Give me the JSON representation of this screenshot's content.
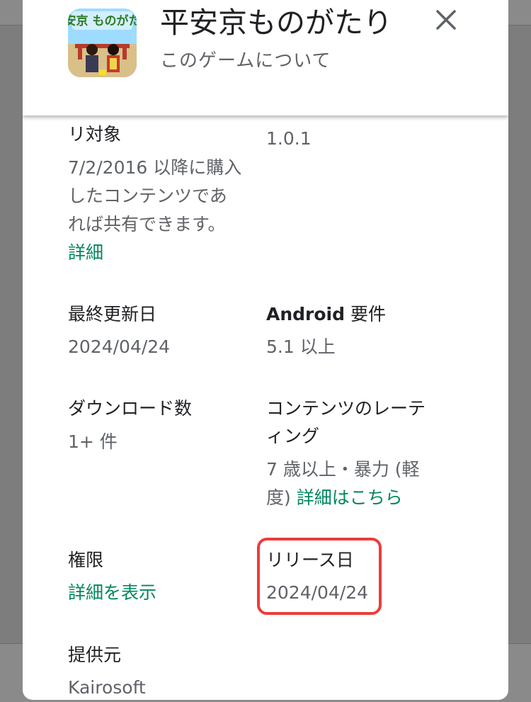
{
  "app": {
    "title": "平安京ものがたり",
    "subtitle": "このゲームについて",
    "icon_logo_text": "平安京 ものがたり"
  },
  "colors": {
    "link": "#01875f",
    "highlight": "#ee3b3b",
    "label": "#202124",
    "value": "#5f6368"
  },
  "icons": {
    "close": "close-icon",
    "app": "app-icon"
  },
  "details": {
    "family_library": {
      "label": "リ対象",
      "value_lines": [
        "7/2/2016 以降に購入",
        "したコンテンツであ",
        "れば共有できます。"
      ],
      "link": "詳細"
    },
    "version": {
      "value": "1.0.1"
    },
    "updated": {
      "label": "最終更新日",
      "value": "2024/04/24"
    },
    "android_req": {
      "label_bold": "Android",
      "label_rest": " 要件",
      "value": "5.1 以上"
    },
    "downloads": {
      "label": "ダウンロード数",
      "value": "1+ 件"
    },
    "rating": {
      "label_lines": [
        "コンテンツのレーテ",
        "ィング"
      ],
      "value_line1": "7 歳以上・暴力 (軽",
      "value_line2": "度) ",
      "link": "詳細はこちら"
    },
    "permissions": {
      "label": "権限",
      "link": "詳細を表示"
    },
    "release": {
      "label": "リリース日",
      "value": "2024/04/24"
    },
    "provider": {
      "label": "提供元",
      "value": "Kairosoft"
    }
  }
}
